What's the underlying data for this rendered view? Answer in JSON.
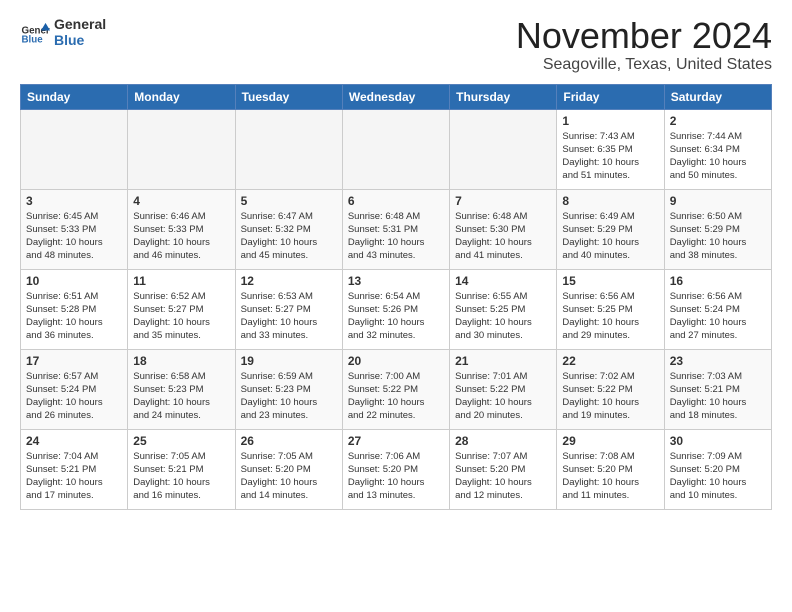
{
  "logo": {
    "general": "General",
    "blue": "Blue"
  },
  "header": {
    "month": "November 2024",
    "location": "Seagoville, Texas, United States"
  },
  "weekdays": [
    "Sunday",
    "Monday",
    "Tuesday",
    "Wednesday",
    "Thursday",
    "Friday",
    "Saturday"
  ],
  "weeks": [
    [
      {
        "day": "",
        "info": ""
      },
      {
        "day": "",
        "info": ""
      },
      {
        "day": "",
        "info": ""
      },
      {
        "day": "",
        "info": ""
      },
      {
        "day": "",
        "info": ""
      },
      {
        "day": "1",
        "info": "Sunrise: 7:43 AM\nSunset: 6:35 PM\nDaylight: 10 hours\nand 51 minutes."
      },
      {
        "day": "2",
        "info": "Sunrise: 7:44 AM\nSunset: 6:34 PM\nDaylight: 10 hours\nand 50 minutes."
      }
    ],
    [
      {
        "day": "3",
        "info": "Sunrise: 6:45 AM\nSunset: 5:33 PM\nDaylight: 10 hours\nand 48 minutes."
      },
      {
        "day": "4",
        "info": "Sunrise: 6:46 AM\nSunset: 5:33 PM\nDaylight: 10 hours\nand 46 minutes."
      },
      {
        "day": "5",
        "info": "Sunrise: 6:47 AM\nSunset: 5:32 PM\nDaylight: 10 hours\nand 45 minutes."
      },
      {
        "day": "6",
        "info": "Sunrise: 6:48 AM\nSunset: 5:31 PM\nDaylight: 10 hours\nand 43 minutes."
      },
      {
        "day": "7",
        "info": "Sunrise: 6:48 AM\nSunset: 5:30 PM\nDaylight: 10 hours\nand 41 minutes."
      },
      {
        "day": "8",
        "info": "Sunrise: 6:49 AM\nSunset: 5:29 PM\nDaylight: 10 hours\nand 40 minutes."
      },
      {
        "day": "9",
        "info": "Sunrise: 6:50 AM\nSunset: 5:29 PM\nDaylight: 10 hours\nand 38 minutes."
      }
    ],
    [
      {
        "day": "10",
        "info": "Sunrise: 6:51 AM\nSunset: 5:28 PM\nDaylight: 10 hours\nand 36 minutes."
      },
      {
        "day": "11",
        "info": "Sunrise: 6:52 AM\nSunset: 5:27 PM\nDaylight: 10 hours\nand 35 minutes."
      },
      {
        "day": "12",
        "info": "Sunrise: 6:53 AM\nSunset: 5:27 PM\nDaylight: 10 hours\nand 33 minutes."
      },
      {
        "day": "13",
        "info": "Sunrise: 6:54 AM\nSunset: 5:26 PM\nDaylight: 10 hours\nand 32 minutes."
      },
      {
        "day": "14",
        "info": "Sunrise: 6:55 AM\nSunset: 5:25 PM\nDaylight: 10 hours\nand 30 minutes."
      },
      {
        "day": "15",
        "info": "Sunrise: 6:56 AM\nSunset: 5:25 PM\nDaylight: 10 hours\nand 29 minutes."
      },
      {
        "day": "16",
        "info": "Sunrise: 6:56 AM\nSunset: 5:24 PM\nDaylight: 10 hours\nand 27 minutes."
      }
    ],
    [
      {
        "day": "17",
        "info": "Sunrise: 6:57 AM\nSunset: 5:24 PM\nDaylight: 10 hours\nand 26 minutes."
      },
      {
        "day": "18",
        "info": "Sunrise: 6:58 AM\nSunset: 5:23 PM\nDaylight: 10 hours\nand 24 minutes."
      },
      {
        "day": "19",
        "info": "Sunrise: 6:59 AM\nSunset: 5:23 PM\nDaylight: 10 hours\nand 23 minutes."
      },
      {
        "day": "20",
        "info": "Sunrise: 7:00 AM\nSunset: 5:22 PM\nDaylight: 10 hours\nand 22 minutes."
      },
      {
        "day": "21",
        "info": "Sunrise: 7:01 AM\nSunset: 5:22 PM\nDaylight: 10 hours\nand 20 minutes."
      },
      {
        "day": "22",
        "info": "Sunrise: 7:02 AM\nSunset: 5:22 PM\nDaylight: 10 hours\nand 19 minutes."
      },
      {
        "day": "23",
        "info": "Sunrise: 7:03 AM\nSunset: 5:21 PM\nDaylight: 10 hours\nand 18 minutes."
      }
    ],
    [
      {
        "day": "24",
        "info": "Sunrise: 7:04 AM\nSunset: 5:21 PM\nDaylight: 10 hours\nand 17 minutes."
      },
      {
        "day": "25",
        "info": "Sunrise: 7:05 AM\nSunset: 5:21 PM\nDaylight: 10 hours\nand 16 minutes."
      },
      {
        "day": "26",
        "info": "Sunrise: 7:05 AM\nSunset: 5:20 PM\nDaylight: 10 hours\nand 14 minutes."
      },
      {
        "day": "27",
        "info": "Sunrise: 7:06 AM\nSunset: 5:20 PM\nDaylight: 10 hours\nand 13 minutes."
      },
      {
        "day": "28",
        "info": "Sunrise: 7:07 AM\nSunset: 5:20 PM\nDaylight: 10 hours\nand 12 minutes."
      },
      {
        "day": "29",
        "info": "Sunrise: 7:08 AM\nSunset: 5:20 PM\nDaylight: 10 hours\nand 11 minutes."
      },
      {
        "day": "30",
        "info": "Sunrise: 7:09 AM\nSunset: 5:20 PM\nDaylight: 10 hours\nand 10 minutes."
      }
    ]
  ]
}
